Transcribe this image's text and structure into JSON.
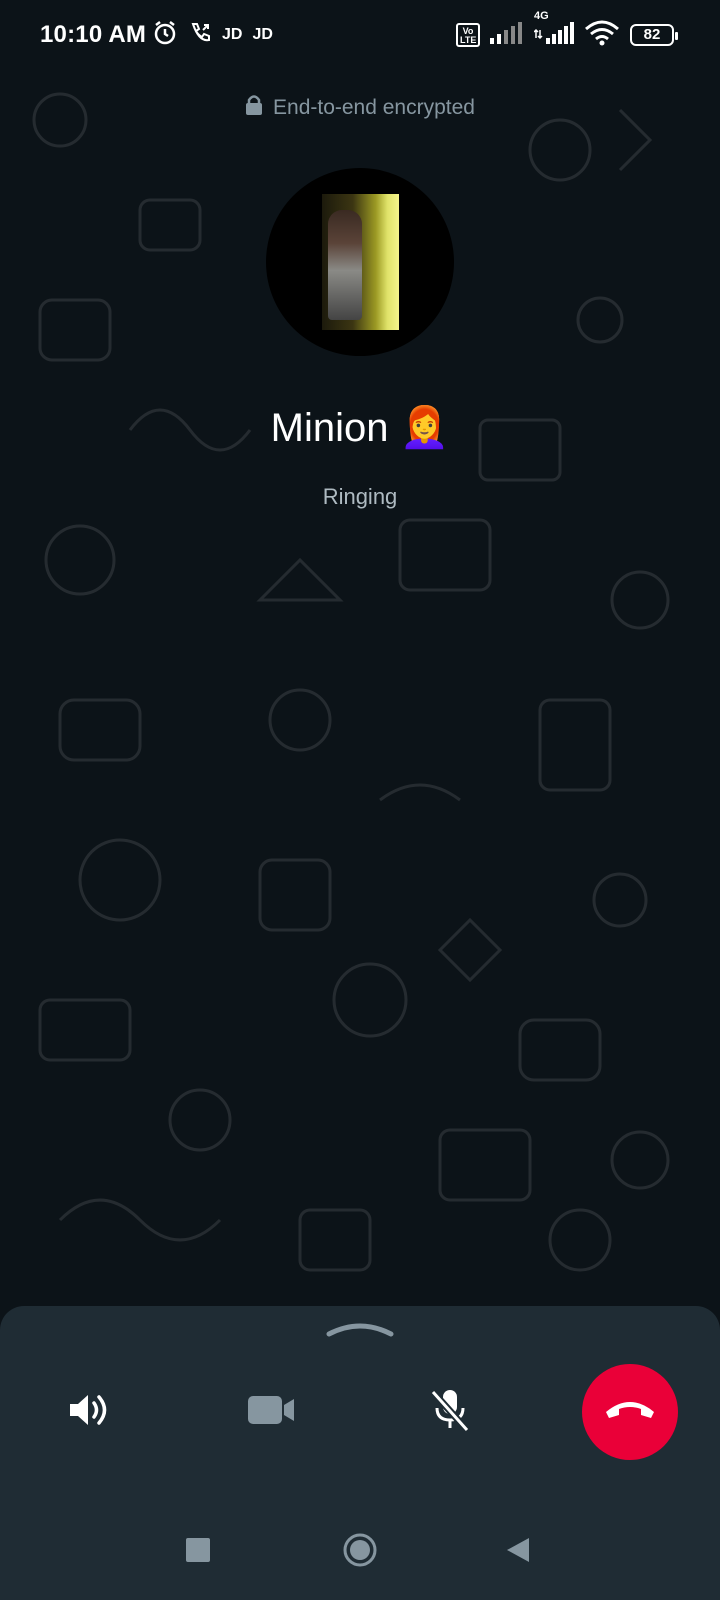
{
  "status_bar": {
    "time": "10:10 AM",
    "carrier1": "JD",
    "carrier2": "JD",
    "volte": "Vo\nLTE",
    "network": "4G",
    "battery": "82",
    "icons": [
      "alarm-icon",
      "wifi-call-icon",
      "signal-icon",
      "wifi-icon"
    ]
  },
  "call": {
    "encryption_text": "End-to-end encrypted",
    "caller_name": "Minion 👩‍🦰",
    "status": "Ringing"
  },
  "controls": {
    "speaker": "speaker-icon",
    "video": "video-icon",
    "mute": "mic-off-icon",
    "end_call": "end-call-icon",
    "end_call_color": "#ea0038"
  },
  "nav": {
    "recents": "recents-icon",
    "home": "home-icon",
    "back": "back-icon"
  },
  "colors": {
    "background": "#0c1318",
    "sheet": "#1f2c34",
    "muted_text": "#8696a0"
  }
}
